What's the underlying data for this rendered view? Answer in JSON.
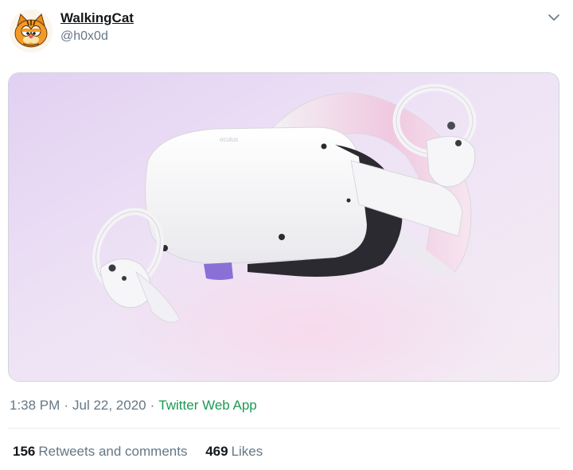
{
  "user": {
    "display_name": "WalkingCat",
    "handle": "@h0x0d",
    "avatar_icon": "garfield-cat-avatar"
  },
  "tweet": {
    "time": "1:38 PM",
    "separator": "·",
    "date": "Jul 22, 2020",
    "source": "Twitter Web App",
    "image_subject": "oculus"
  },
  "stats": {
    "retweets_count": "156",
    "retweets_label": "Retweets and comments",
    "likes_count": "469",
    "likes_label": "Likes"
  },
  "colors": {
    "link": "#1b9a52",
    "secondary_text": "#657786",
    "primary_text": "#14171a",
    "border": "#ccd6dd"
  },
  "icons": {
    "menu": "chevron-down-icon"
  }
}
